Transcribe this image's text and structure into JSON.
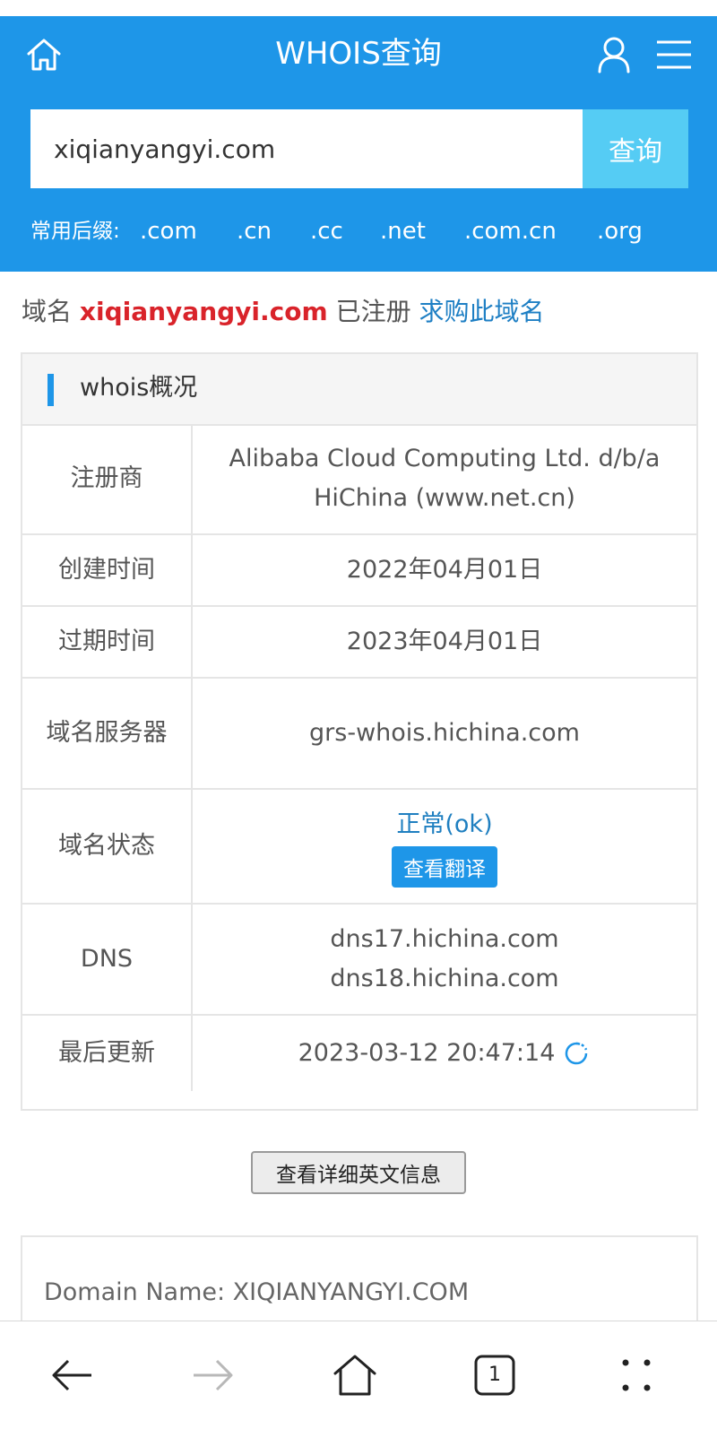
{
  "header": {
    "title": "WHOIS查询",
    "search_value": "xiqianyangyi.com",
    "search_button": "查询",
    "suffix_label": "常用后缀:",
    "suffixes": [
      ".com",
      ".cn",
      ".cc",
      ".net",
      ".com.cn",
      ".org"
    ]
  },
  "status": {
    "prefix": "域名",
    "domain": "xiqianyangyi.com",
    "state": "已注册",
    "buy_link": "求购此域名"
  },
  "whois": {
    "title": "whois概况",
    "rows": [
      {
        "label": "注册商",
        "value": "Alibaba Cloud Computing Ltd. d/b/a HiChina (www.net.cn)"
      },
      {
        "label": "创建时间",
        "value": "2022年04月01日"
      },
      {
        "label": "过期时间",
        "value": "2023年04月01日"
      },
      {
        "label": "域名服务器",
        "value": "grs-whois.hichina.com"
      },
      {
        "label": "域名状态",
        "value": "正常(ok)",
        "button": "查看翻译"
      },
      {
        "label": "DNS",
        "values": [
          "dns17.hichina.com",
          "dns18.hichina.com"
        ]
      },
      {
        "label": "最后更新",
        "value": "2023-03-12 20:47:14"
      }
    ]
  },
  "detail_button": "查看详细英文信息",
  "raw": {
    "first_line": "Domain Name: XIQIANYANGYI.COM"
  },
  "browser": {
    "tab_count": "1"
  },
  "colors": {
    "brand_blue": "#1e96e8",
    "search_button": "#55ccf4",
    "domain_red": "#d9232a",
    "link_blue": "#1e7fc4"
  },
  "icons": {
    "home": "home-icon",
    "user": "user-icon",
    "menu": "menu-icon",
    "refresh": "refresh-icon",
    "back": "back-arrow-icon",
    "forward": "forward-arrow-icon",
    "browser_home": "browser-home-icon",
    "tabs": "tabs-icon",
    "more": "more-icon"
  }
}
